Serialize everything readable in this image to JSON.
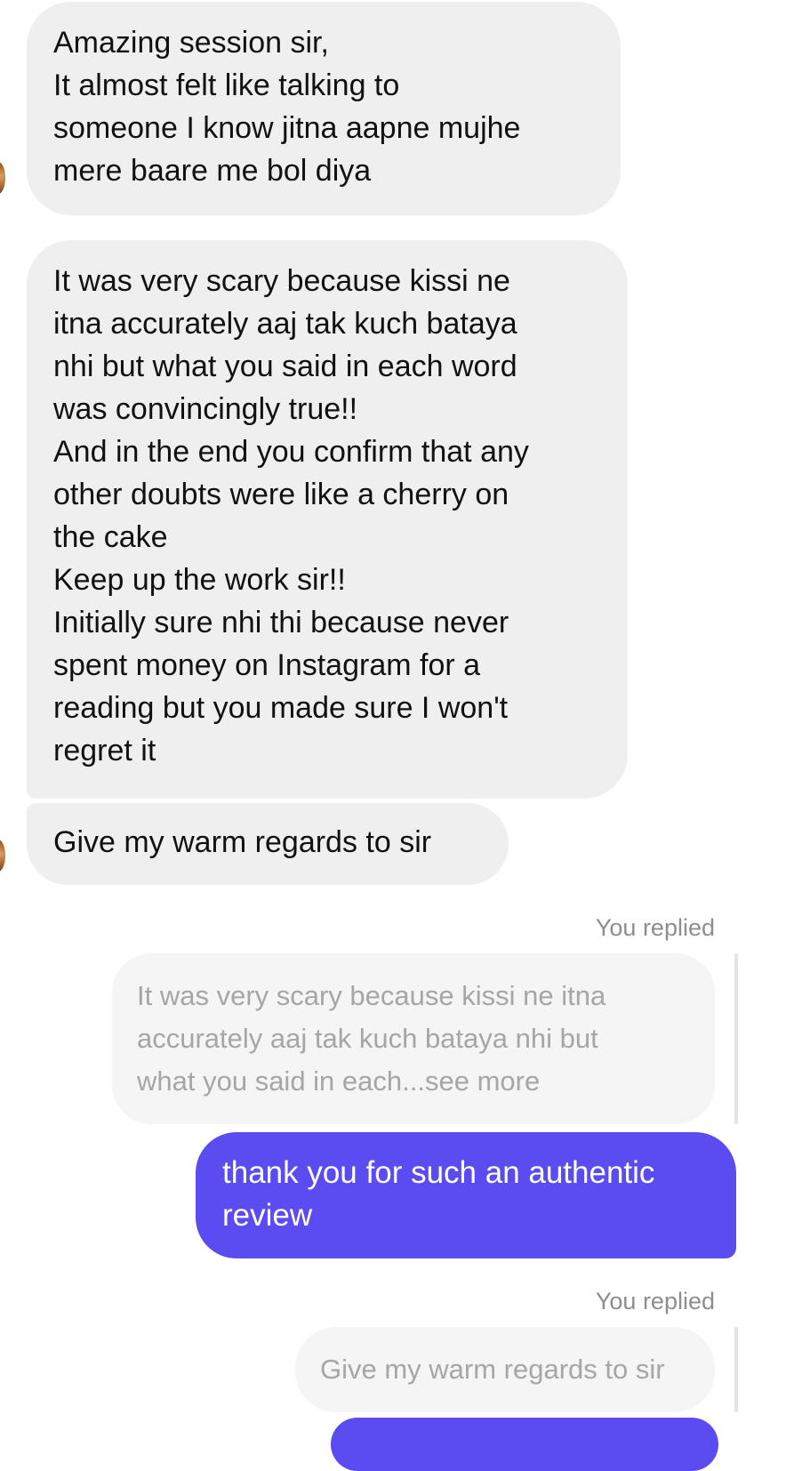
{
  "conversation": {
    "messages": [
      {
        "direction": "incoming",
        "text": "Amazing session sir,\nIt almost felt like talking to\nsomeone I know jitna aapne mujhe\nmere baare me bol diya"
      },
      {
        "direction": "incoming",
        "text": "It was very scary because kissi ne\nitna accurately aaj tak kuch bataya\nnhi but what you said in each word\nwas convincingly true!!\nAnd in the end you confirm that any\nother doubts were like a cherry on\nthe cake\nKeep up the work sir!!\nInitially sure nhi thi because never\nspent money on Instagram for a\nreading but you made sure I won't\nregret it"
      },
      {
        "direction": "incoming",
        "text": "Give my warm regards to sir"
      }
    ],
    "replies": [
      {
        "label": "You replied",
        "quoted_text": "It was very scary because kissi ne itna\naccurately aaj tak kuch bataya nhi but\nwhat you said in each...see more",
        "reply_text": "thank you for such an authentic\nreview"
      },
      {
        "label": "You replied",
        "quoted_text": "Give my warm regards to sir",
        "reply_text": ""
      }
    ]
  },
  "colors": {
    "incoming_bubble": "#efefef",
    "outgoing_bubble": "#5b4cf2",
    "quoted_text": "#a6a6a6",
    "meta_text": "#8e8e8e"
  }
}
